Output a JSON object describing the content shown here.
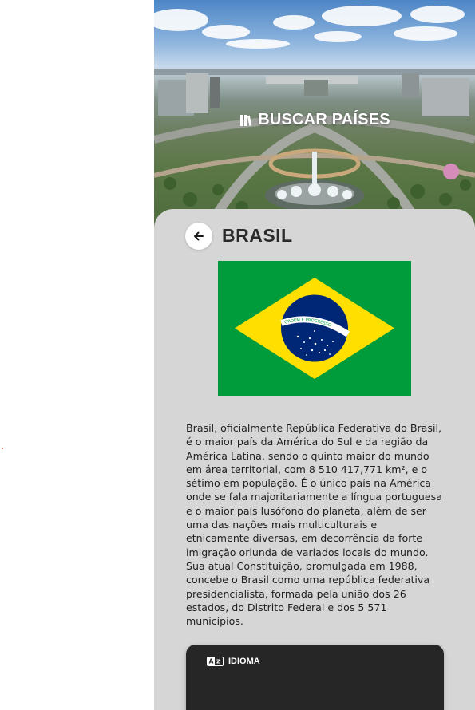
{
  "header": {
    "title": "BUSCAR PAÍSES",
    "icon": "book-icon"
  },
  "country": {
    "name": "BRASIL",
    "flag_motto": "ORDEM E PROGRESSO",
    "flag_colors": {
      "green": "#009c3b",
      "yellow": "#ffdf00",
      "blue": "#002776",
      "white": "#ffffff"
    },
    "description": "Brasil, oficialmente República Federativa do Brasil, é o maior país da América do Sul e da região da América Latina, sendo o quinto maior do mundo em área territorial, com 8 510 417,771 km², e o sétimo em população. É o único país na América onde se fala majoritariamente a língua portuguesa e o maior país lusófono do planeta, além de ser uma das nações mais multiculturais e etnicamente diversas, em decorrência da forte imigração oriunda de variados locais do mundo. Sua atual Constituição, promulgada em 1988, concebe o Brasil como uma república federativa presidencialista, formada pela união dos 26 estados, do Distrito Federal e dos 5 571 municípios."
  },
  "language_panel": {
    "label": "IDIOMA",
    "icon": "translate-icon"
  },
  "colors": {
    "card_background": "#d6d6d6",
    "panel_background": "#262626",
    "text": "#1f1f1f"
  },
  "back_icon": "arrow-left-icon"
}
